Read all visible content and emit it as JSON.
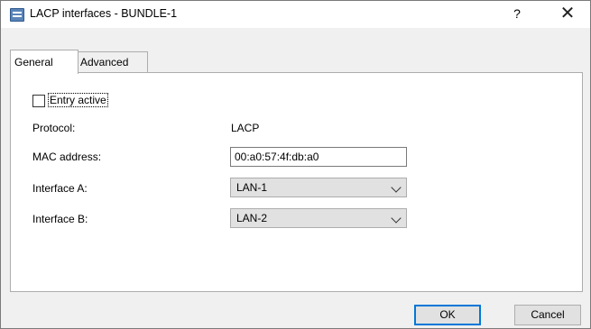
{
  "window": {
    "title": "LACP interfaces - BUNDLE-1",
    "help": "?",
    "close": "✕"
  },
  "tabs": [
    {
      "label": "General",
      "active": true
    },
    {
      "label": "Advanced",
      "active": false
    }
  ],
  "form": {
    "entry_active": {
      "label": "Entry active",
      "checked": false
    },
    "protocol": {
      "label": "Protocol:",
      "value": "LACP"
    },
    "mac": {
      "label": "MAC address:",
      "value": "00:a0:57:4f:db:a0"
    },
    "interface_a": {
      "label": "Interface A:",
      "value": "LAN-1"
    },
    "interface_b": {
      "label": "Interface B:",
      "value": "LAN-2"
    }
  },
  "buttons": {
    "ok": "OK",
    "cancel": "Cancel"
  },
  "colors": {
    "accent": "#0078d7",
    "button_bg": "#e1e1e1"
  }
}
